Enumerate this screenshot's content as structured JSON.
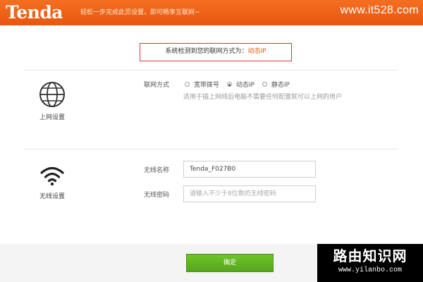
{
  "header": {
    "logo": "Tenda",
    "slogan": "轻松一步完成此页设置，即可畅享互联网~",
    "watermark": "www.it528.com"
  },
  "detection": {
    "prefix": "系统检测到您的联网方式为：",
    "mode": "动态IP"
  },
  "internet": {
    "section_label": "上网设置",
    "method_label": "联网方式",
    "options": [
      {
        "label": "宽带拨号",
        "checked": false
      },
      {
        "label": "动态IP",
        "checked": true
      },
      {
        "label": "静态IP",
        "checked": false
      }
    ],
    "hint": "适用于插上网线后电脑不需要任何配置就可以上网的用户"
  },
  "wireless": {
    "section_label": "无线设置",
    "ssid_label": "无线名称",
    "ssid_value": "Tenda_F027B0",
    "password_label": "无线密码",
    "password_placeholder": "请输入不少于8位数的无线密码"
  },
  "footer": {
    "ok_label": "确定"
  },
  "watermark_bottom": {
    "name": "路由知识网",
    "url": "www.yilanbo.com"
  },
  "colors": {
    "header_orange": "#e8560f",
    "detect_border": "#d9343a",
    "ok_green": "#5cb321"
  }
}
